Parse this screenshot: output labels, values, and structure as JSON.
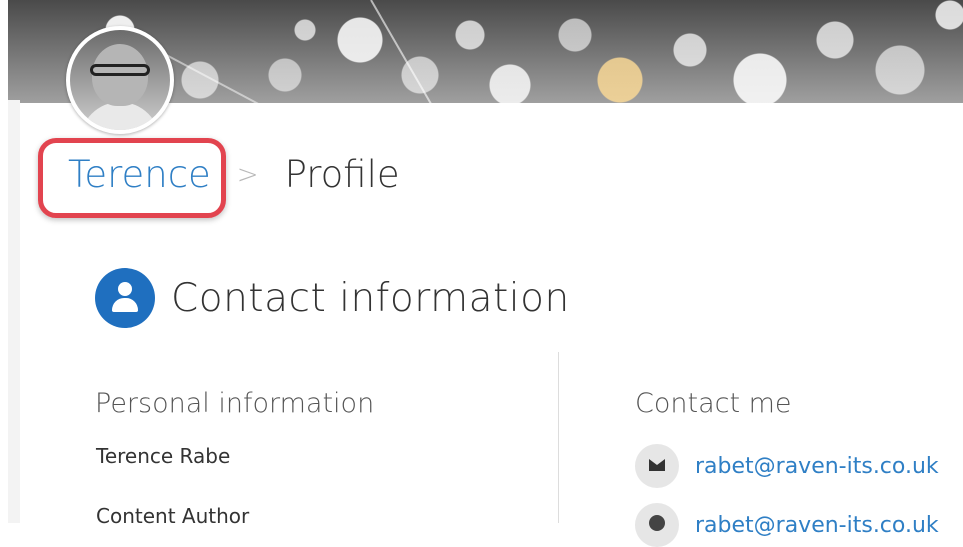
{
  "profile": {
    "breadcrumb": {
      "user_name": "Terence",
      "separator": ">",
      "current_page": "Profile"
    }
  },
  "contact_section": {
    "title": "Contact information",
    "personal": {
      "heading": "Personal information",
      "name": "Terence Rabe",
      "role": "Content Author"
    },
    "contact_me": {
      "heading": "Contact me",
      "email": "rabet@raven-its.co.uk",
      "im": "rabet@raven-its.co.uk"
    }
  },
  "colors": {
    "link_blue": "#2f7fc5",
    "highlight_red": "#e2444f",
    "icon_blue": "#1f6fbf"
  }
}
